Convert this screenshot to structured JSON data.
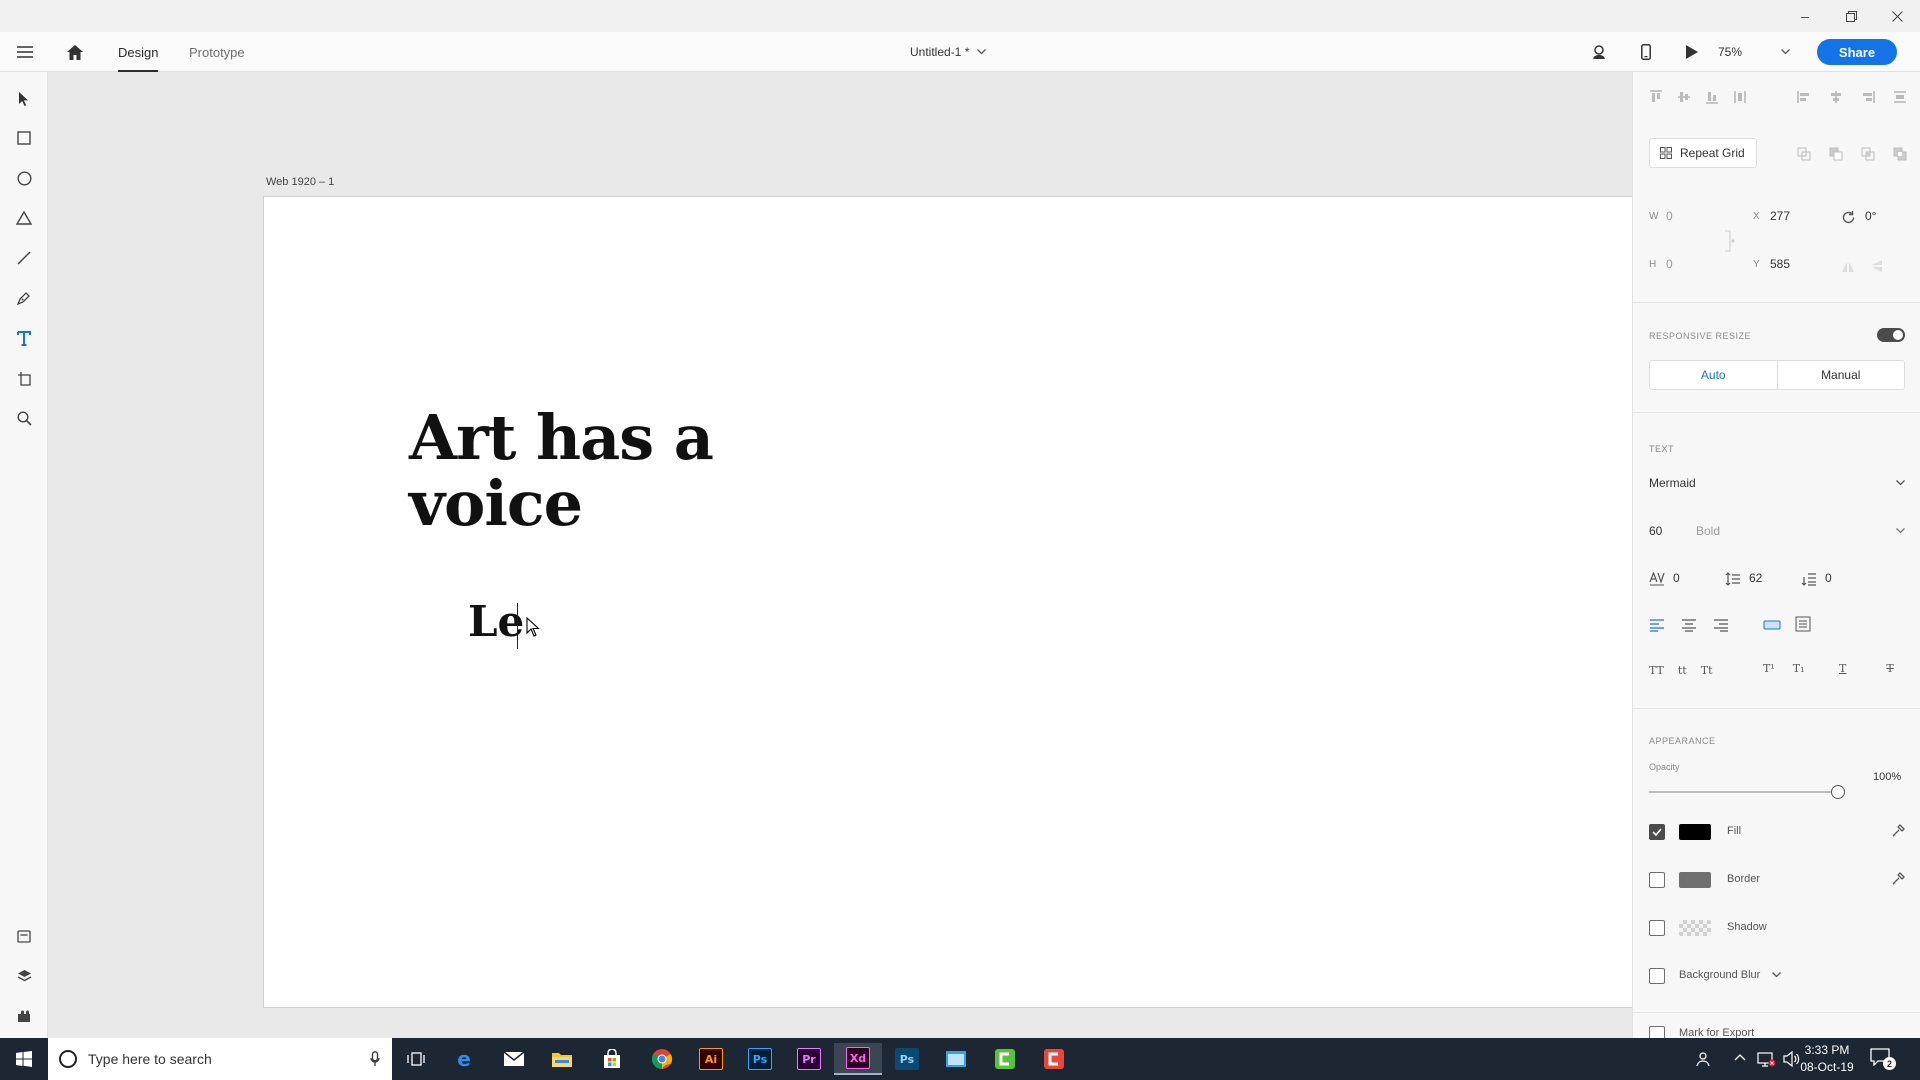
{
  "app": {
    "tabs": [
      {
        "label": "Design"
      },
      {
        "label": "Prototype"
      }
    ],
    "document_title": "Untitled-1 *",
    "zoom": "75%",
    "share_label": "Share"
  },
  "canvas": {
    "artboard_label": "Web 1920 – 1",
    "headline": "Art has a\nvoice",
    "typing_text": "Le"
  },
  "panel": {
    "repeat_grid_label": "Repeat Grid",
    "transform": {
      "w_label": "W",
      "w_value": "0",
      "h_label": "H",
      "h_value": "0",
      "x_label": "X",
      "x_value": "277",
      "y_label": "Y",
      "y_value": "585",
      "rotation": "0°"
    },
    "responsive_resize": {
      "title": "RESPONSIVE RESIZE",
      "auto_label": "Auto",
      "manual_label": "Manual",
      "enabled": true
    },
    "text": {
      "title": "TEXT",
      "font_family": "Mermaid",
      "font_size": "60",
      "font_weight": "Bold",
      "char_spacing": "0",
      "line_spacing": "62",
      "paragraph_spacing": "0"
    },
    "appearance": {
      "title": "APPEARANCE",
      "opacity_label": "Opacity",
      "opacity_value": "100%",
      "opacity_level": 1.0,
      "fill_label": "Fill",
      "fill_checked": true,
      "fill_color": "#000000",
      "border_label": "Border",
      "border_checked": false,
      "border_color": "#707070",
      "shadow_label": "Shadow",
      "shadow_checked": false,
      "blur_label": "Background Blur",
      "blur_checked": false
    },
    "export_label": "Mark for Export"
  },
  "taskbar": {
    "search_placeholder": "Type here to search",
    "apps": [
      {
        "name": "task-view",
        "label": ""
      },
      {
        "name": "edge",
        "label": "e"
      },
      {
        "name": "mail",
        "label": ""
      },
      {
        "name": "file-explorer",
        "label": ""
      },
      {
        "name": "store",
        "label": ""
      },
      {
        "name": "chrome",
        "label": ""
      },
      {
        "name": "illustrator",
        "label": "Ai"
      },
      {
        "name": "photoshop",
        "label": "Ps"
      },
      {
        "name": "premiere",
        "label": "Pr"
      },
      {
        "name": "xd",
        "label": "Xd"
      },
      {
        "name": "photoshop-2",
        "label": "Ps"
      },
      {
        "name": "app-blue",
        "label": ""
      },
      {
        "name": "camtasia-green",
        "label": ""
      },
      {
        "name": "camtasia-red",
        "label": ""
      }
    ],
    "time": "3:33 PM",
    "date": "08-Oct-19",
    "notification_count": "2"
  },
  "colors": {
    "accent": "#1473e6",
    "xd_pink": "#ff61f6",
    "taskbar": "#1c2733"
  }
}
